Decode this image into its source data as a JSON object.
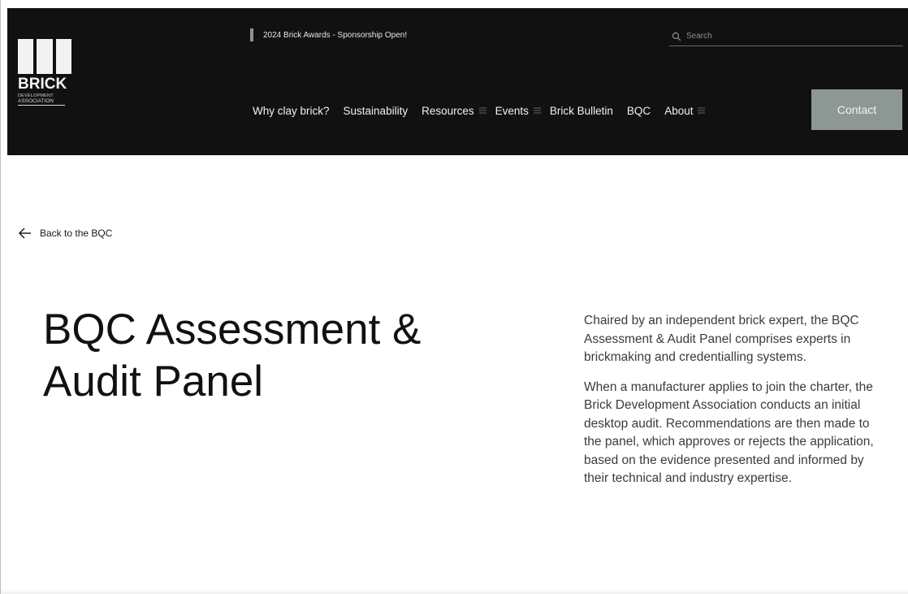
{
  "header": {
    "logo": {
      "word": "BRICK",
      "line1": "DEVELOPMENT",
      "line2": "ASSOCIATION"
    },
    "announcement": "2024 Brick Awards - Sponsorship Open!",
    "search": {
      "placeholder": "Search",
      "value": ""
    },
    "nav": [
      {
        "label": "Why clay brick?",
        "has_menu": false
      },
      {
        "label": "Sustainability",
        "has_menu": false
      },
      {
        "label": "Resources",
        "has_menu": true
      },
      {
        "label": "Events",
        "has_menu": true
      },
      {
        "label": "Brick Bulletin",
        "has_menu": false
      },
      {
        "label": "BQC",
        "has_menu": false
      },
      {
        "label": "About",
        "has_menu": true
      }
    ],
    "contact_label": "Contact"
  },
  "main": {
    "back_label": "Back to the BQC",
    "title": "BQC Assessment & Audit Panel",
    "paragraphs": [
      "Chaired by an independent brick expert, the BQC Assessment & Audit Panel comprises experts in brickmaking and credentialling systems.",
      "When a manufacturer applies to join the charter, the Brick Development Association conducts an initial desktop audit. Recommendations are then made to the panel, which approves or rejects the application, based on the evidence presented and informed by their technical and industry expertise."
    ]
  },
  "icons": {
    "search": "search-icon",
    "menu": "menu-icon",
    "back": "arrow-left-icon"
  },
  "colors": {
    "header_bg": "#111111",
    "accent": "#8d9894",
    "text_dark": "#111111",
    "text_body": "#3b3b3b"
  }
}
